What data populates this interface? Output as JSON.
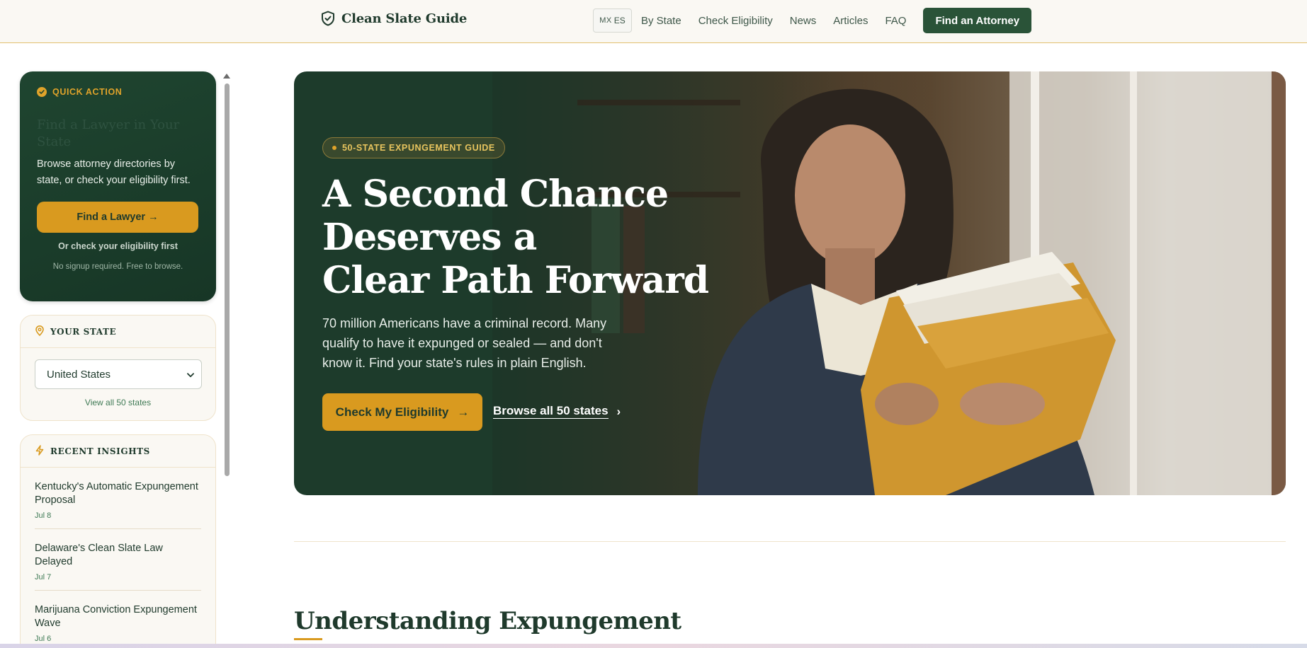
{
  "header": {
    "brand": "Clean Slate Guide",
    "lang_flag": "MX",
    "lang_code": "ES",
    "nav": [
      "By State",
      "Check Eligibility",
      "News",
      "Articles",
      "FAQ"
    ],
    "cta": "Find an Attorney"
  },
  "sidebar": {
    "quick_action": {
      "label": "QUICK ACTION",
      "title": "Find a Lawyer in Your State",
      "description": "Browse attorney directories by state, or check your eligibility first.",
      "button": "Find a Lawyer →",
      "alt_link": "Or check your eligibility first",
      "note": "No signup required. Free to browse."
    },
    "your_state": {
      "label": "YOUR STATE",
      "selected": "United States",
      "link": "View all 50 states"
    },
    "recent_insights": {
      "label": "RECENT INSIGHTS",
      "items": [
        {
          "title": "Kentucky's Automatic Expungement Proposal",
          "date": "Jul 8"
        },
        {
          "title": "Delaware's Clean Slate Law Delayed",
          "date": "Jul 7"
        },
        {
          "title": "Marijuana Conviction Expungement Wave",
          "date": "Jul 6"
        }
      ]
    }
  },
  "hero": {
    "badge": "50-STATE EXPUNGEMENT GUIDE",
    "title_line1": "A Second Chance",
    "title_line2": "Deserves a",
    "title_line3": "Clear Path Forward",
    "subtitle": "70 million Americans have a criminal record. Many qualify to have it expunged or sealed — and don't know it. Find your state's rules in plain English.",
    "primary_cta": "Check My Eligibility",
    "primary_arrow": "→",
    "secondary_cta": "Browse all 50 states",
    "secondary_arrow": "›"
  },
  "section": {
    "title": "Understanding Expungement"
  },
  "colors": {
    "brand_green": "#2a5338",
    "dark_green": "#1d3b2b",
    "gold": "#d99a1f",
    "cream": "#faf8f3"
  }
}
